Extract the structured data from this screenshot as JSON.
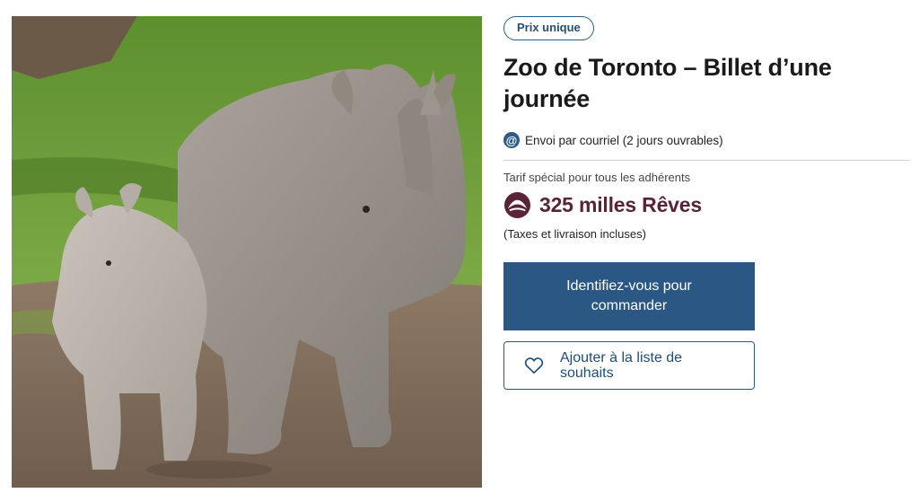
{
  "product": {
    "badge": "Prix unique",
    "title": "Zoo de Toronto – Billet d’une journée",
    "delivery": "Envoi par courriel (2 jours ouvrables)",
    "member_note": "Tarif spécial pour tous les adhérents",
    "price": "325 milles Rêves",
    "tax_note": "(Taxes et livraison incluses)",
    "image_alt": "Deux rhinocéros blancs"
  },
  "actions": {
    "login_label": "Identifiez-vous pour commander",
    "wishlist_label": "Ajouter à la liste de souhaits"
  },
  "icons": {
    "delivery": "at-icon",
    "price": "dream-icon",
    "wishlist": "heart-icon"
  },
  "colors": {
    "primary": "#2b5784",
    "price": "#5a2338"
  }
}
